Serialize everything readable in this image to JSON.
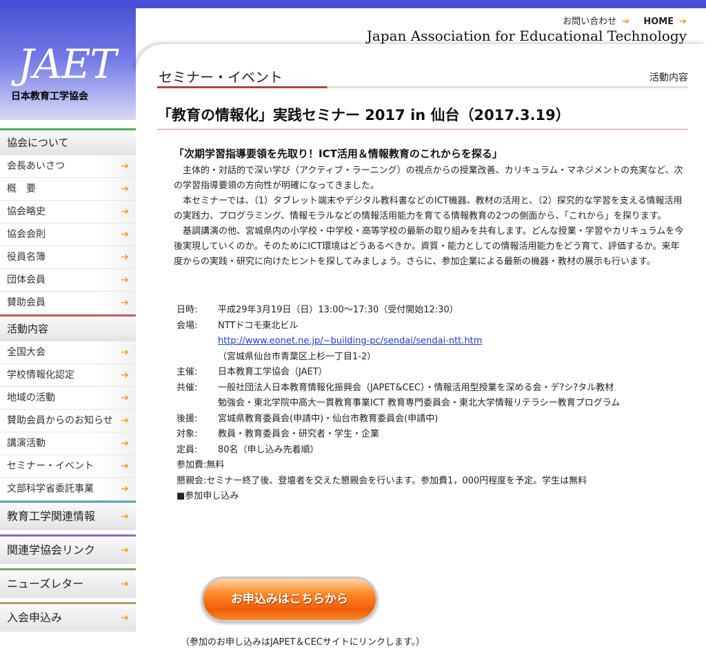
{
  "header": {
    "contact": "お問い合わせ",
    "home": "HOME",
    "arrow": "➔",
    "english_name": "Japan Association for Educational Technology"
  },
  "logo": {
    "text": "JAET",
    "subtitle": "日本教育工学協会"
  },
  "sidebar": {
    "about": "協会について",
    "about_items": [
      "会長あいさつ",
      "概　要",
      "協会略史",
      "協会会則",
      "役員名簿",
      "団体会員",
      "賛助会員"
    ],
    "activities": "活動内容",
    "activity_items": [
      "全国大会",
      "学校情報化認定",
      "地域の活動",
      "賛助会員からのお知らせ",
      "講演活動",
      "セミナー・イベント",
      "文部科学省委託事業"
    ],
    "info": "教育工学関連情報",
    "links": "関連学協会リンク",
    "news": "ニューズレター",
    "join": "入会申込み"
  },
  "main": {
    "category": "セミナー・イベント",
    "category_right": "活動内容",
    "title": "「教育の情報化」実践セミナー 2017 in 仙台（2017.3.19）",
    "lead": "「次期学習指導要領を先取り！ICT活用＆情報教育のこれからを探る」",
    "paragraphs": [
      "主体的・対話的で深い学び（アクティブ・ラーニング）の視点からの授業改善、カリキュラム・マネジメントの充実など、次の学習指導要領の方向性が明確になってきました。",
      "本セミナーでは、（1）タブレット端末やデジタル教科書などのICT機器、教材の活用と、（2）探究的な学習を支える情報活用の実践力、プログラミング、情報モラルなどの情報活用能力を育てる情報教育の2つの側面から、「これから」を探ります。",
      "基調講演の他、宮城県内の小学校・中学校・高等学校の最新の取り組みを共有します。どんな授業・学習やカリキュラムを今後実現していくのか。そのためにICT環境はどうあるべきか。資質・能力としての情報活用能力をどう育て、評価するか。来年度からの実践・研究に向けたヒントを探してみましょう。さらに、参加企業による最新の機器・教材の展示も行います。"
    ],
    "info": {
      "date_k": "日時:",
      "date_v": "平成29年3月19日（日）13:00〜17:30（受付開始12:30）",
      "venue_k": "会場:",
      "venue_v": "NTTドコモ東北ビル",
      "venue_link": "http://www.eonet.ne.jp/~building-pc/sendai/sendai-ntt.htm",
      "venue_addr": "（宮城県仙台市青葉区上杉一丁目1-2）",
      "host_k": "主催:",
      "host_v": "日本教育工学協会（JAET）",
      "cohost_k": "共催:",
      "cohost_v1": "一般社団法人日本教育情報化振興会（JAPET&CEC）・情報活用型授業を深める会・デ?シ?タル教材",
      "cohost_v2": "勉強会・東北学院中高大一貫教育事業ICT 教育専門委員会・東北大学情報リテラシー教育プログラム",
      "support_k": "後援:",
      "support_v": "宮城県教育委員会(申請中)・仙台市教育委員会(申請中)",
      "target_k": "対象:",
      "target_v": "教員・教育委員会・研究者・学生・企業",
      "capacity_k": "定員:",
      "capacity_v": "80名（申し込み先着順）",
      "fee_k": "参加費:",
      "fee_v": "無料",
      "party_k": "懇親会:",
      "party_v": "セミナー終了後、登壇者を交えた懇親会を行います。参加費1，000円程度を予定。学生は無料",
      "apply_head": "■参加申し込み"
    },
    "apply_button": "お申込みはこちらから",
    "apply_note": "（参加のお申し込みはJAPET＆CECサイトにリンクします。）"
  }
}
